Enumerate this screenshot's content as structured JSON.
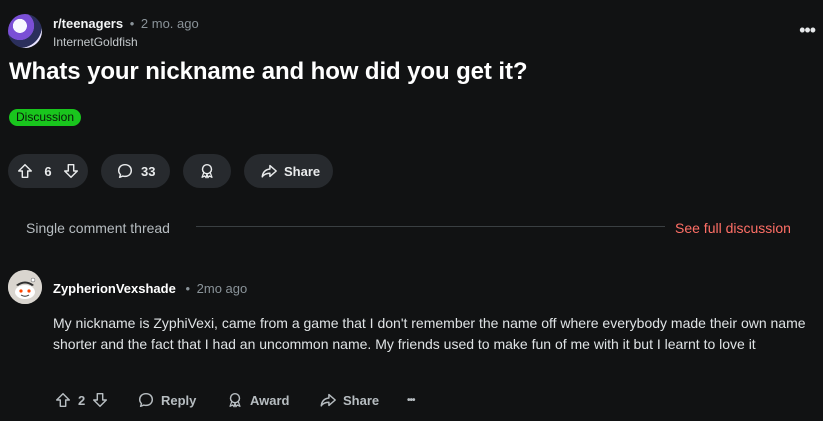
{
  "post": {
    "subreddit": "r/teenagers",
    "separator": "•",
    "age": "2 mo. ago",
    "author": "InternetGoldfish",
    "more": "•••",
    "title": "Whats your nickname and how did you get it?",
    "flair": "Discussion",
    "flair_color": "#19c51d",
    "votes": "6",
    "comments": "33",
    "share_label": "Share"
  },
  "thread": {
    "label": "Single comment thread",
    "see_full": "See full discussion"
  },
  "comment": {
    "author": "ZypherionVexshade",
    "separator": "•",
    "age": "2mo ago",
    "body": "My nickname is ZyphiVexi, came from a game that I don't remember the name off where everybody made their own name shorter and the fact that I had an uncommon name. My friends used to make fun of me with it but I learnt to love it",
    "votes": "2",
    "reply_label": "Reply",
    "award_label": "Award",
    "share_label": "Share",
    "more": "•••"
  },
  "colors": {
    "background": "#111213",
    "link_accent": "#ff6f66",
    "pill_bg": "#272a2e"
  }
}
